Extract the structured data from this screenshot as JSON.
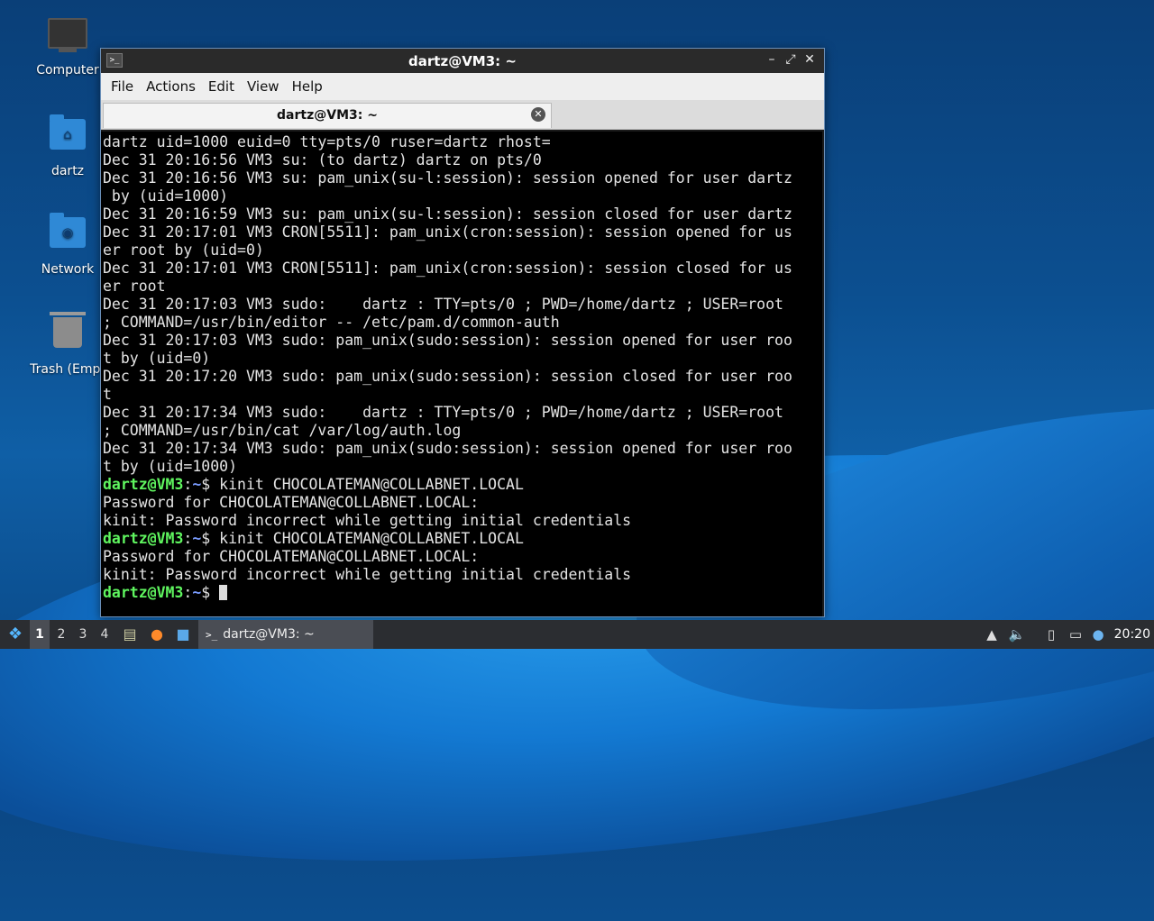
{
  "desktop": {
    "icons": [
      {
        "label": "Computer",
        "icon": "computer-icon"
      },
      {
        "label": "dartz",
        "icon": "home-folder-icon"
      },
      {
        "label": "Network",
        "icon": "network-folder-icon"
      },
      {
        "label": "Trash (Empt",
        "icon": "trash-icon"
      }
    ]
  },
  "window": {
    "title": "dartz@VM3: ~",
    "controls": {
      "minimize": "–",
      "maximize": "⤢",
      "close": "✕"
    },
    "menu": [
      "File",
      "Actions",
      "Edit",
      "View",
      "Help"
    ],
    "tab": {
      "label": "dartz@VM3: ~",
      "close": "✕"
    }
  },
  "terminal": {
    "prompt_user": "dartz@VM3",
    "prompt_sep": ":",
    "prompt_path": "~",
    "prompt_end": "$ ",
    "lines": [
      "dartz uid=1000 euid=0 tty=pts/0 ruser=dartz rhost=",
      "Dec 31 20:16:56 VM3 su: (to dartz) dartz on pts/0",
      "Dec 31 20:16:56 VM3 su: pam_unix(su-l:session): session opened for user dartz",
      " by (uid=1000)",
      "Dec 31 20:16:59 VM3 su: pam_unix(su-l:session): session closed for user dartz",
      "Dec 31 20:17:01 VM3 CRON[5511]: pam_unix(cron:session): session opened for us",
      "er root by (uid=0)",
      "Dec 31 20:17:01 VM3 CRON[5511]: pam_unix(cron:session): session closed for us",
      "er root",
      "Dec 31 20:17:03 VM3 sudo:    dartz : TTY=pts/0 ; PWD=/home/dartz ; USER=root",
      "; COMMAND=/usr/bin/editor -- /etc/pam.d/common-auth",
      "Dec 31 20:17:03 VM3 sudo: pam_unix(sudo:session): session opened for user roo",
      "t by (uid=0)",
      "Dec 31 20:17:20 VM3 sudo: pam_unix(sudo:session): session closed for user roo",
      "t",
      "Dec 31 20:17:34 VM3 sudo:    dartz : TTY=pts/0 ; PWD=/home/dartz ; USER=root",
      "; COMMAND=/usr/bin/cat /var/log/auth.log",
      "Dec 31 20:17:34 VM3 sudo: pam_unix(sudo:session): session opened for user roo",
      "t by (uid=1000)"
    ],
    "cmd1": "kinit CHOCOLATEMAN@COLLABNET.LOCAL",
    "out1a": "Password for CHOCOLATEMAN@COLLABNET.LOCAL:",
    "out1b": "kinit: Password incorrect while getting initial credentials",
    "cmd2": "kinit CHOCOLATEMAN@COLLABNET.LOCAL",
    "out2a": "Password for CHOCOLATEMAN@COLLABNET.LOCAL:",
    "out2b": "kinit: Password incorrect while getting initial credentials"
  },
  "taskbar": {
    "workspaces": [
      "1",
      "2",
      "3",
      "4"
    ],
    "active_workspace": "1",
    "launchers": [
      "file-manager-icon",
      "firefox-icon",
      "desktop-icon"
    ],
    "task": {
      "label": "dartz@VM3: ~",
      "icon": "terminal-icon"
    },
    "tray": [
      "notifications-icon",
      "volume-icon",
      "clipboard-icon",
      "network-icon",
      "updates-icon"
    ],
    "clock": "20:20"
  },
  "colors": {
    "prompt": "#5ff55f",
    "path": "#7a9cff",
    "accent": "#55b7ff"
  }
}
